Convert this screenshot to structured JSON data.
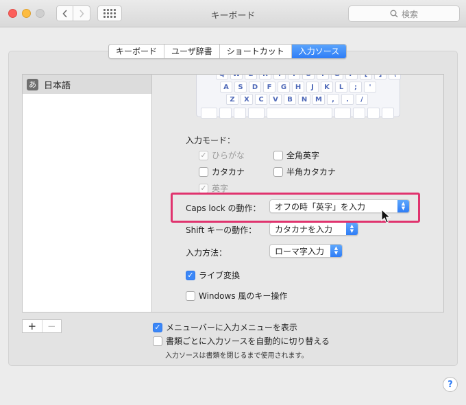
{
  "window": {
    "title": "キーボード"
  },
  "search": {
    "placeholder": "検索",
    "icon": "magnifier-icon"
  },
  "tabs": [
    {
      "label": "キーボード",
      "active": false
    },
    {
      "label": "ユーザ辞書",
      "active": false
    },
    {
      "label": "ショートカット",
      "active": false
    },
    {
      "label": "入力ソース",
      "active": true
    }
  ],
  "sources": [
    {
      "icon_char": "あ",
      "label": "日本語",
      "selected": true
    }
  ],
  "list_buttons": {
    "add": "+",
    "remove": "−"
  },
  "keyboard": {
    "row1": [
      "Q",
      "W",
      "E",
      "R",
      "T",
      "Y",
      "U",
      "I",
      "O",
      "P",
      "[",
      "]",
      "\\"
    ],
    "row2": [
      "A",
      "S",
      "D",
      "F",
      "G",
      "H",
      "J",
      "K",
      "L",
      ";",
      "'"
    ],
    "row3": [
      "Z",
      "X",
      "C",
      "V",
      "B",
      "N",
      "M",
      ",",
      ".",
      "/"
    ]
  },
  "input_mode": {
    "heading": "入力モード：",
    "options": [
      {
        "label": "ひらがな",
        "checked": true,
        "disabled": true
      },
      {
        "label": "全角英字",
        "checked": false,
        "disabled": false
      },
      {
        "label": "カタカナ",
        "checked": false,
        "disabled": false
      },
      {
        "label": "半角カタカナ",
        "checked": false,
        "disabled": false
      },
      {
        "label": "英字",
        "checked": true,
        "disabled": true
      }
    ]
  },
  "caps_lock": {
    "label": "Caps lock の動作：",
    "value": "オフの時「英字」を入力"
  },
  "shift": {
    "label": "Shift キーの動作：",
    "value": "カタカナを入力"
  },
  "input_method": {
    "label": "入力方法：",
    "value": "ローマ字入力"
  },
  "live_conversion": {
    "label": "ライブ変換",
    "checked": true
  },
  "windows_style": {
    "label": "Windows 風のキー操作",
    "checked": false
  },
  "menu_bar": {
    "label": "メニューバーに入力メニューを表示",
    "checked": true
  },
  "auto_switch": {
    "label": "書類ごとに入力ソースを自動的に切り替える",
    "checked": false
  },
  "auto_switch_note": "入力ソースは書類を閉じるまで使用されます。",
  "help": "?",
  "colors": {
    "accent": "#2f7df6",
    "highlight": "#e0336e"
  }
}
